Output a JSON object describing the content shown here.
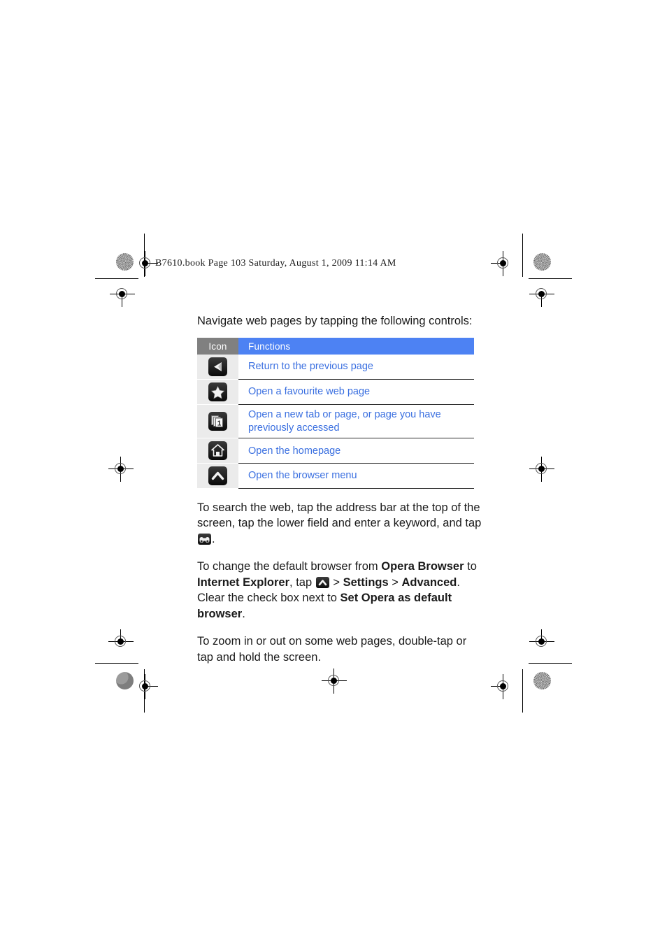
{
  "header": {
    "file_line": "B7610.book  Page 103  Saturday, August 1, 2009  11:14 AM"
  },
  "main": {
    "intro": "Navigate web pages by tapping the following controls:",
    "table": {
      "columns": [
        "Icon",
        "Functions"
      ],
      "rows": [
        {
          "icon": "back-arrow-icon",
          "function": "Return to the previous page"
        },
        {
          "icon": "star-icon",
          "function": "Open a favourite web page"
        },
        {
          "icon": "tabs-icon",
          "function": "Open a new tab or page, or page you have previously accessed"
        },
        {
          "icon": "home-icon",
          "function": "Open the homepage"
        },
        {
          "icon": "chevron-up-icon",
          "function": "Open the browser menu"
        }
      ]
    },
    "paragraphs": {
      "search": {
        "part1": "To search the web, tap the address bar at the top of the screen, tap the lower field and enter a keyword, and tap ",
        "icon": "binoculars-icon",
        "part2": "."
      },
      "default_browser": {
        "part1": "To change the default browser from ",
        "bold1": "Opera Browser",
        "part2": " to ",
        "bold2": "Internet Explorer",
        "part3": ", tap ",
        "icon": "chevron-up-icon",
        "part4": " > ",
        "bold3": "Settings",
        "part5": " > ",
        "bold4": "Advanced",
        "part6": ". Clear the check box next to ",
        "bold5": "Set Opera as default browser",
        "part7": "."
      },
      "zoom": "To zoom in or out on some web pages, double-tap or tap and hold the screen."
    }
  },
  "colors": {
    "header_icon_bg": "#808080",
    "header_func_bg": "#4d82f3",
    "icon_cell_bg": "#ebebeb",
    "link_blue": "#3a6fe0",
    "text_black": "#1a1a1a"
  }
}
